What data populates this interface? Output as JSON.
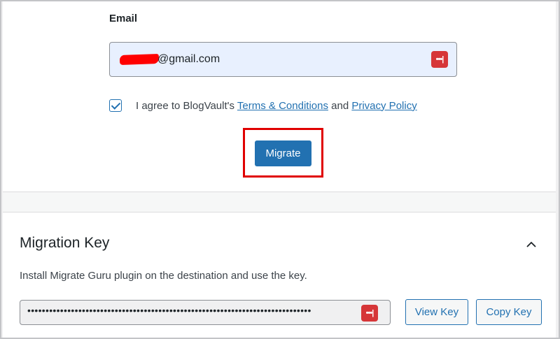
{
  "form": {
    "email_label": "Email",
    "email_value_visible": "@gmail.com",
    "password_icon": "password-manager-icon",
    "agree_prefix": "I agree to BlogVault's ",
    "terms_link": "Terms & Conditions",
    "agree_and": " and ",
    "privacy_link": "Privacy Policy",
    "agree_checked": true,
    "migrate_label": "Migrate"
  },
  "migration_key": {
    "title": "Migration Key",
    "description": "Install Migrate Guru plugin on the destination and use the key.",
    "key_masked": "••••••••••••••••••••••••••••••••••••••••••••••••••••••••••••••••••••••••••••••",
    "view_key_label": "View Key",
    "copy_key_label": "Copy Key",
    "collapse_icon": "chevron-up-icon"
  },
  "colors": {
    "accent": "#2271b1",
    "highlight": "#e00000",
    "password_icon_bg": "#d63638",
    "autofill_bg": "#e8f0fe"
  }
}
